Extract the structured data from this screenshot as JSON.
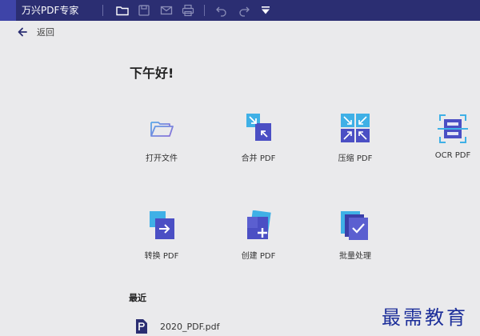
{
  "titlebar": {
    "app_title": "万兴PDF专家",
    "icons": [
      "folder-icon",
      "save-icon",
      "mail-icon",
      "print-icon",
      "undo-icon",
      "redo-icon",
      "dropdown-icon"
    ]
  },
  "nav": {
    "back_label": "返回"
  },
  "main": {
    "greeting": "下午好!",
    "tools": [
      {
        "label": "打开文件",
        "icon": "open-folder-icon"
      },
      {
        "label": "合并 PDF",
        "icon": "merge-icon"
      },
      {
        "label": "压缩 PDF",
        "icon": "compress-icon"
      },
      {
        "label": "OCR PDF",
        "icon": "ocr-icon"
      },
      {
        "label": "转换 PDF",
        "icon": "convert-icon"
      },
      {
        "label": "创建 PDF",
        "icon": "create-icon"
      },
      {
        "label": "批量处理",
        "icon": "batch-icon"
      }
    ],
    "recent_title": "最近",
    "recent_files": [
      {
        "name": "2020_PDF.pdf",
        "icon": "pdf-file-icon"
      }
    ]
  },
  "watermark": "最需教育",
  "colors": {
    "titlebar": "#2b2e72",
    "accent": "#4b4fc4",
    "watermark": "#1d2f9a"
  }
}
